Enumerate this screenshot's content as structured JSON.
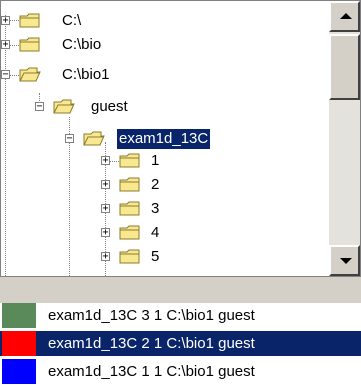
{
  "tree": {
    "nodes": [
      {
        "label": "C:\\",
        "expander": "+"
      },
      {
        "label": "C:\\bio",
        "expander": "+"
      },
      {
        "label": "C:\\bio1",
        "expander": "−"
      },
      {
        "label": "guest",
        "expander": "−"
      },
      {
        "label": "exam1d_13C",
        "expander": "−"
      },
      {
        "label": "1",
        "expander": "+"
      },
      {
        "label": "2",
        "expander": "+"
      },
      {
        "label": "3",
        "expander": "+"
      },
      {
        "label": "4",
        "expander": "+"
      },
      {
        "label": "5",
        "expander": "+"
      }
    ]
  },
  "list": {
    "rows": [
      {
        "text": "exam1d_13C  3  1   C:\\bio1   guest",
        "color": "#5a8a5a"
      },
      {
        "text": "exam1d_13C  2  1   C:\\bio1   guest",
        "color": "#ff0000"
      },
      {
        "text": "exam1d_13C  1  1   C:\\bio1   guest",
        "color": "#0000ff"
      }
    ]
  },
  "colors": {
    "selection": "#0a246a",
    "folder_fill": "#f8e890",
    "folder_edge": "#8c7a2c"
  }
}
